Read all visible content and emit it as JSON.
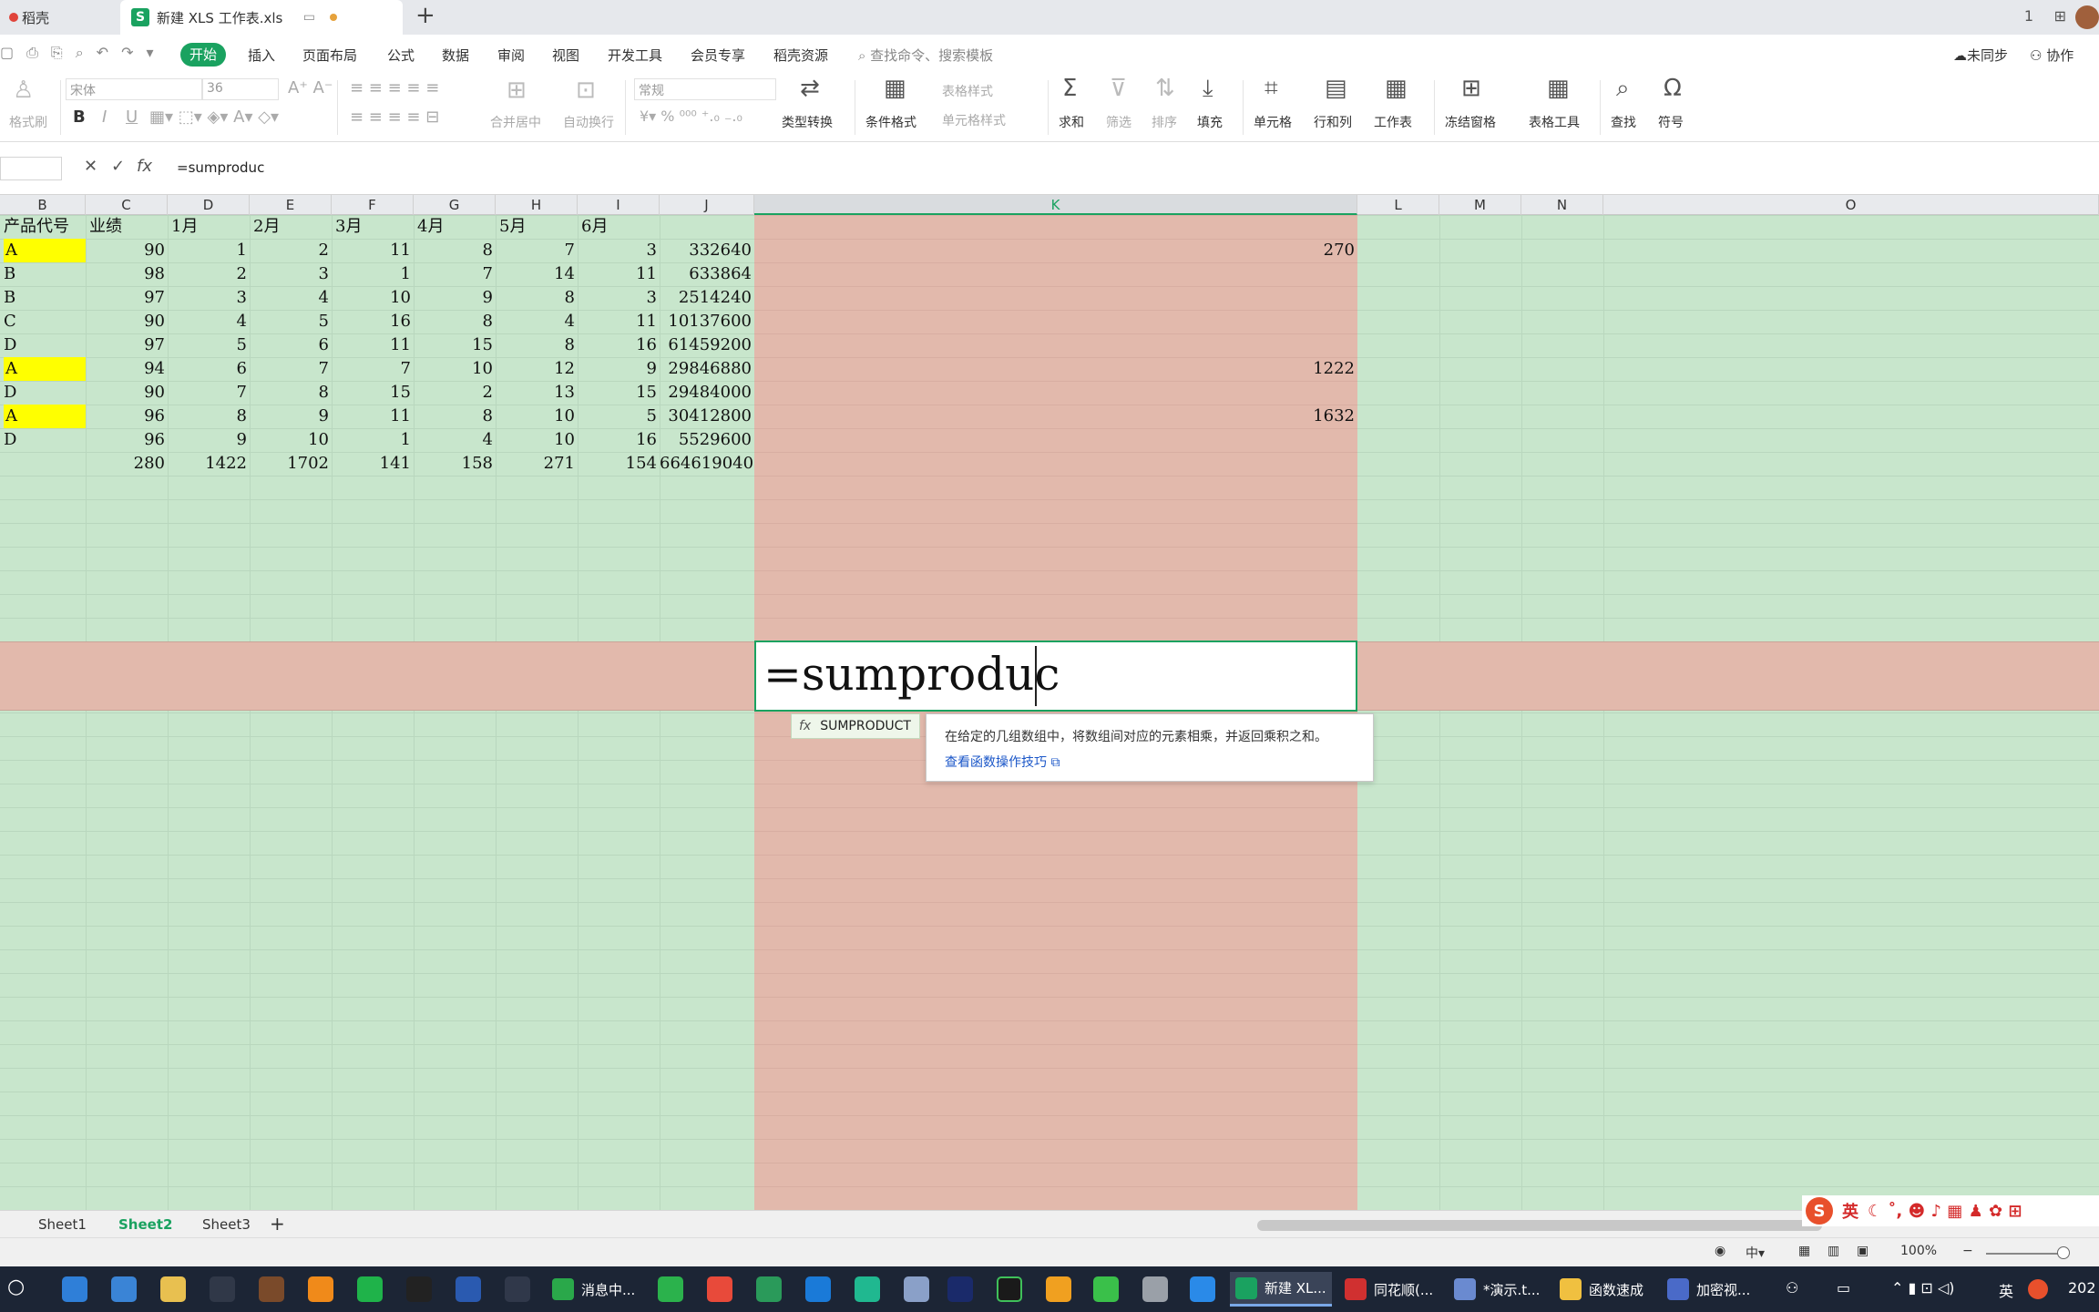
{
  "tabs": {
    "inactive_label": "稻壳",
    "active_label": "新建 XLS 工作表.xls",
    "window_icons": [
      "1",
      "⊞"
    ]
  },
  "menu": {
    "start": "开始",
    "items": [
      "插入",
      "页面布局",
      "公式",
      "数据",
      "审阅",
      "视图",
      "开发工具",
      "会员专享",
      "稻壳资源"
    ],
    "search_placeholder": "查找命令、搜索模板",
    "sync": "未同步",
    "collab": "协作"
  },
  "ribbon": {
    "format_painter": "格式刷",
    "font_name": "宋体",
    "font_size": "36",
    "merge_center": "合并居中",
    "wrap_text": "自动换行",
    "number_format": "常规",
    "type_convert": "类型转换",
    "cond_format": "条件格式",
    "table_style": "表格样式",
    "cell_style": "单元格样式",
    "sum": "求和",
    "filter": "筛选",
    "sort": "排序",
    "fill": "填充",
    "cell": "单元格",
    "rowcol": "行和列",
    "worksheet": "工作表",
    "freeze": "冻结窗格",
    "table_tools": "表格工具",
    "find": "查找",
    "symbol": "符号"
  },
  "formula_bar": {
    "name_box": "",
    "fx": "fx",
    "formula": "=sumproduc"
  },
  "columns": [
    "B",
    "C",
    "D",
    "E",
    "F",
    "G",
    "H",
    "I",
    "J",
    "K",
    "L",
    "M",
    "N",
    "O"
  ],
  "selected_column": "K",
  "table": {
    "header": [
      "产品代号",
      "业绩",
      "1月",
      "2月",
      "3月",
      "4月",
      "5月",
      "6月"
    ],
    "rows": [
      [
        "A",
        "90",
        "1",
        "2",
        "11",
        "8",
        "7",
        "3",
        "332640",
        "270"
      ],
      [
        "B",
        "98",
        "2",
        "3",
        "1",
        "7",
        "14",
        "11",
        "633864",
        ""
      ],
      [
        "B",
        "97",
        "3",
        "4",
        "10",
        "9",
        "8",
        "3",
        "2514240",
        ""
      ],
      [
        "C",
        "90",
        "4",
        "5",
        "16",
        "8",
        "4",
        "11",
        "10137600",
        ""
      ],
      [
        "D",
        "97",
        "5",
        "6",
        "11",
        "15",
        "8",
        "16",
        "61459200",
        ""
      ],
      [
        "A",
        "94",
        "6",
        "7",
        "7",
        "10",
        "12",
        "9",
        "29846880",
        "1222"
      ],
      [
        "D",
        "90",
        "7",
        "8",
        "15",
        "2",
        "13",
        "15",
        "29484000",
        ""
      ],
      [
        "A",
        "96",
        "8",
        "9",
        "11",
        "8",
        "10",
        "5",
        "30412800",
        "1632"
      ],
      [
        "D",
        "96",
        "9",
        "10",
        "1",
        "4",
        "10",
        "16",
        "5529600",
        ""
      ]
    ],
    "totals": [
      "",
      "280",
      "1422",
      "1702",
      "141",
      "158",
      "271",
      "154",
      "664619040",
      ""
    ],
    "highlight_color": "#ffff00"
  },
  "editing": {
    "text": "=sumproduc",
    "autocomplete": "SUMPRODUCT",
    "tip_description": "在给定的几组数组中，将数组间对应的元素相乘，并返回乘积之和。",
    "tip_link": "查看函数操作技巧"
  },
  "sheets": [
    "Sheet1",
    "Sheet2",
    "Sheet3"
  ],
  "active_sheet": "Sheet2",
  "ime": {
    "label": "英"
  },
  "status": {
    "zoom": "100%"
  },
  "taskbar": {
    "apps": [
      "消息中...",
      "新建 XL...",
      "同花顺(...",
      "*演示.t...",
      "函数速成",
      "加密视..."
    ],
    "tray_lang": "英",
    "clock": "202"
  },
  "colors": {
    "accent": "#1aa260",
    "grid_bg": "#c8e6cc",
    "selected_col": "#e2b9ac",
    "taskbar": "#1c2535"
  }
}
